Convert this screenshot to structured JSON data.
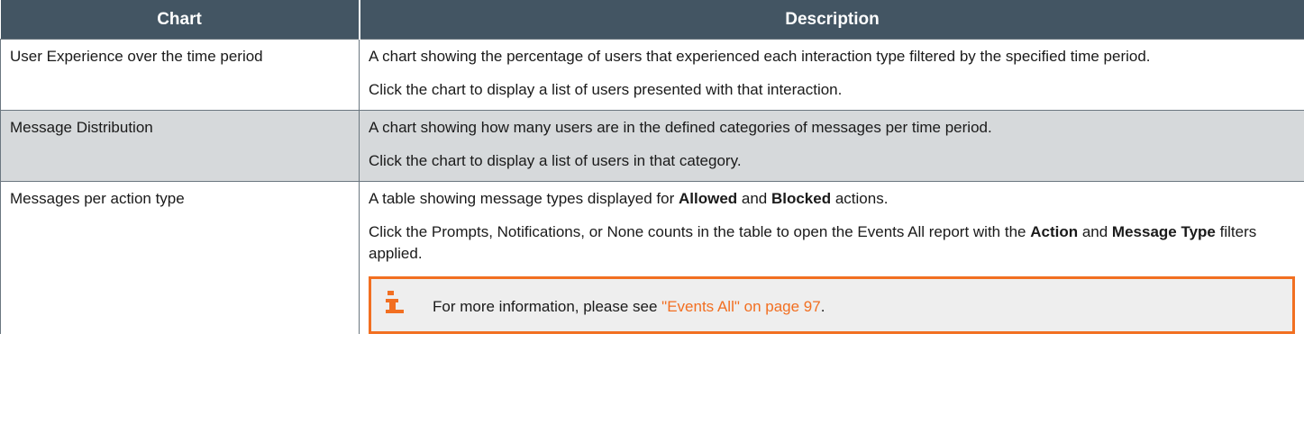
{
  "table": {
    "headers": {
      "chart": "Chart",
      "description": "Description"
    },
    "rows": [
      {
        "chart": "User Experience over the time period",
        "p1": "A chart showing the percentage of users that experienced each interaction type filtered by the specified time period.",
        "p2": "Click the chart to display a list of users presented with that interaction."
      },
      {
        "chart": "Message Distribution",
        "p1": "A chart showing how many users are in the defined categories of messages per time period.",
        "p2": "Click the chart to display a list of users in that category."
      },
      {
        "chart": "Messages per action type",
        "p1_pre": "A table showing message types displayed for ",
        "p1_b1": "Allowed",
        "p1_mid": " and ",
        "p1_b2": "Blocked",
        "p1_post": " actions.",
        "p2_pre": "Click the Prompts, Notifications, or None counts in the table to open the Events All report with the ",
        "p2_b1": "Action",
        "p2_mid": " and ",
        "p2_b2": "Message Type",
        "p2_post": " filters applied.",
        "note": {
          "icon": "info-icon",
          "text_pre": "For more information, please see ",
          "link": "\"Events All\" on page 97",
          "text_post": "."
        }
      }
    ]
  },
  "colors": {
    "header_bg": "#435563",
    "shaded_row": "#d6d9db",
    "accent": "#f26f21"
  }
}
